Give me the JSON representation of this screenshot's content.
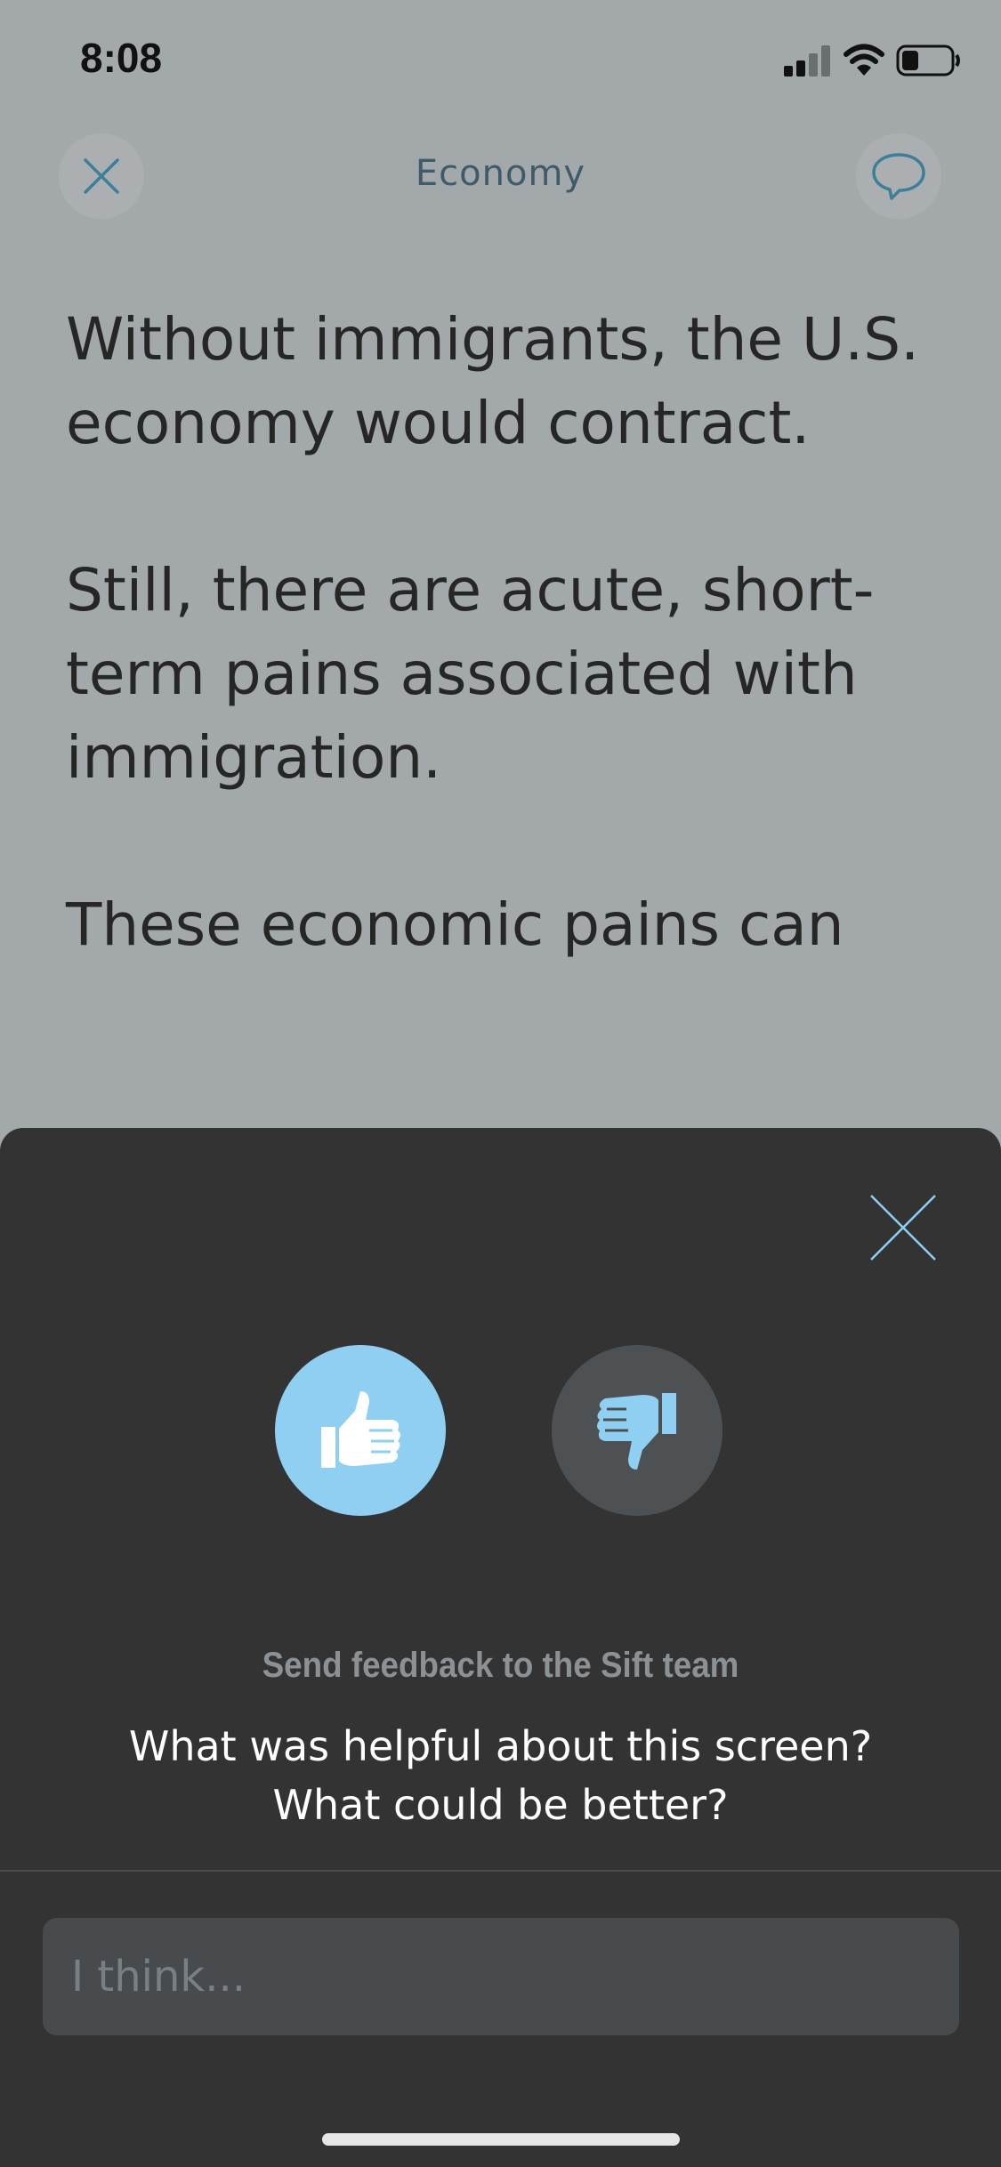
{
  "status_bar": {
    "time": "8:08",
    "signal_icon": "cellular-signal-icon",
    "wifi_icon": "wifi-icon",
    "battery_icon": "battery-icon"
  },
  "nav": {
    "title": "Economy",
    "close_icon": "close-icon",
    "comment_icon": "comment-bubble-icon"
  },
  "article": {
    "paragraphs": [
      "Without immigrants, the U.S. economy would contract.",
      "Still, there are acute, short-term pains associated with immigration.",
      "These economic pains can"
    ]
  },
  "feedback_sheet": {
    "close_icon": "close-icon",
    "thumbs_up_icon": "thumbs-up-icon",
    "thumbs_down_icon": "thumbs-down-icon",
    "label": "Send feedback to the Sift team",
    "question_line1": "What was helpful about this screen?",
    "question_line2": "What could be better?",
    "input_placeholder": "I think...",
    "colors": {
      "accent": "#8ecff2",
      "sheet_bg": "#333333",
      "inactive_button": "#4d5154"
    }
  }
}
